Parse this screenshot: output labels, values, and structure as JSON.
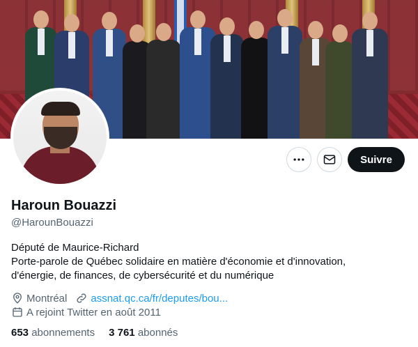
{
  "profile": {
    "name": "Haroun Bouazzi",
    "handle": "@HarounBouazzi",
    "bio_lines": [
      "Député de Maurice-Richard",
      "Porte-parole de Québec solidaire en matière d'économie et d'innovation,",
      "d'énergie, de finances, de cybersécurité et du numérique"
    ],
    "location": "Montréal",
    "link_text": "assnat.qc.ca/fr/deputes/bou...",
    "joined": "A rejoint Twitter en août 2011"
  },
  "actions": {
    "follow_label": "Suivre",
    "more_icon": "more-horizontal-icon",
    "message_icon": "envelope-icon"
  },
  "stats": {
    "following_count": "653",
    "following_label": "abonnements",
    "followers_count": "3 761",
    "followers_label": "abonnés"
  },
  "colors": {
    "text": "#0f1419",
    "secondary": "#536471",
    "link": "#1d9bf0",
    "button": "#0f1419"
  }
}
